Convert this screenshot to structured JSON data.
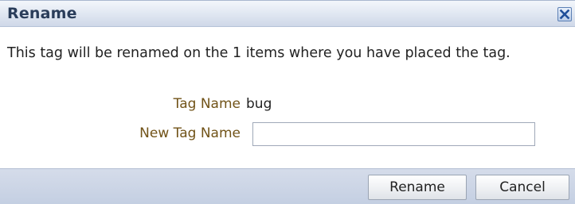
{
  "dialog": {
    "title": "Rename",
    "close_icon": "close-x-icon",
    "message": "This tag will be renamed on the 1 items where you have placed the tag.",
    "fields": {
      "tag_name_label": "Tag Name",
      "tag_name_value": "bug",
      "new_tag_name_label": "New Tag Name",
      "new_tag_name_value": "",
      "new_tag_name_placeholder": ""
    },
    "buttons": {
      "rename_label": "Rename",
      "cancel_label": "Cancel"
    }
  },
  "colors": {
    "title_text": "#2a3d5a",
    "label_text": "#715318",
    "close_icon": "#1f4f9a",
    "footer_bg": "#c9d3e5"
  }
}
